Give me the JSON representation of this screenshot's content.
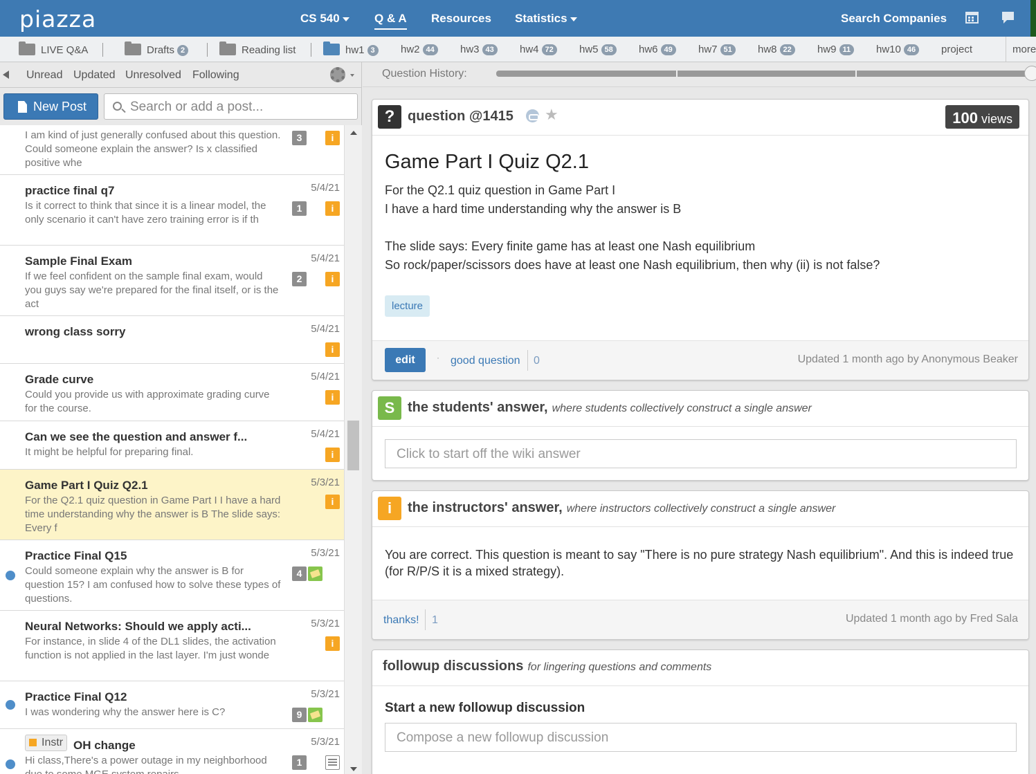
{
  "nav": {
    "logo": "piazza",
    "course": "CS 540",
    "qa": "Q & A",
    "resources": "Resources",
    "statistics": "Statistics",
    "search_companies": "Search Companies"
  },
  "folders": [
    {
      "label": "LIVE Q&A",
      "count": ""
    },
    {
      "label": "Drafts",
      "count": "2"
    },
    {
      "label": "Reading list",
      "count": ""
    },
    {
      "label": "hw1",
      "count": "3"
    },
    {
      "label": "hw2",
      "count": "44"
    },
    {
      "label": "hw3",
      "count": "43"
    },
    {
      "label": "hw4",
      "count": "72"
    },
    {
      "label": "hw5",
      "count": "58"
    },
    {
      "label": "hw6",
      "count": "49"
    },
    {
      "label": "hw7",
      "count": "51"
    },
    {
      "label": "hw8",
      "count": "22"
    },
    {
      "label": "hw9",
      "count": "11"
    },
    {
      "label": "hw10",
      "count": "46"
    },
    {
      "label": "project",
      "count": ""
    },
    {
      "label": "more",
      "count": ""
    }
  ],
  "filters": {
    "unread": "Unread",
    "updated": "Updated",
    "unresolved": "Unresolved",
    "following": "Following"
  },
  "newpost": "New Post",
  "search_placeholder": "Search or add a post...",
  "posts": [
    {
      "title": "",
      "body": "I am kind of just generally confused about this question. Could someone explain the answer? Is x classified positive whe",
      "date": "",
      "count": "3"
    },
    {
      "title": "practice final q7",
      "body": "Is it correct to think that since it is a linear model, the only scenario it can't have zero training error is if th",
      "date": "5/4/21",
      "count": "1"
    },
    {
      "title": "Sample Final Exam",
      "body": "If we feel confident on the sample final exam, would you guys say we're prepared for the final itself, or is the act",
      "date": "5/4/21",
      "count": "2"
    },
    {
      "title": "wrong class sorry",
      "body": "",
      "date": "5/4/21",
      "count": ""
    },
    {
      "title": "Grade curve",
      "body": "Could you provide us with approximate grading curve for the course.",
      "date": "5/4/21",
      "count": ""
    },
    {
      "title": "Can we see the question and answer f...",
      "body": "It might be helpful for preparing final.",
      "date": "5/4/21",
      "count": ""
    },
    {
      "title": "Game Part I Quiz Q2.1",
      "body": "For the Q2.1 quiz question in Game Part I  I have a hard time understanding why the answer is B The slide says: Every f",
      "date": "5/3/21",
      "count": ""
    },
    {
      "title": "Practice Final Q15",
      "body": "Could someone explain why the answer is B for question 15? I am confused how to solve these types of questions.",
      "date": "5/3/21",
      "count": "4"
    },
    {
      "title": "Neural Networks: Should we apply acti...",
      "body": "For instance, in slide 4 of the DL1 slides, the activation function is not applied in the last layer. I'm just wonde",
      "date": "5/3/21",
      "count": ""
    },
    {
      "title": "Practice Final Q12",
      "body": "I was wondering why the answer here is C?",
      "date": "5/3/21",
      "count": "9"
    },
    {
      "title": "OH change",
      "body": "Hi class,There's a power outage in my neighborhood due to some MGE system repairs",
      "date": "5/3/21",
      "count": "1",
      "instr": "Instr"
    }
  ],
  "badge_i": "i",
  "history_label": "Question History:",
  "question": {
    "icon": "?",
    "header": "question @1415",
    "views_num": "100",
    "views_label": "views",
    "title": "Game Part I Quiz Q2.1",
    "lines": [
      "For the Q2.1 quiz question in Game Part I",
      "I have a hard time understanding why the answer is B",
      "",
      "The slide says: Every finite game has at least one Nash equilibrium",
      "So rock/paper/scissors does have at least one Nash equilibrium, then why (ii) is not false?"
    ],
    "tag": "lecture",
    "edit": "edit",
    "dot": "·",
    "good": "good question",
    "good_count": "0",
    "updated": "Updated 1 month ago by Anonymous Beaker"
  },
  "students": {
    "icon": "S",
    "title": "the students' answer,",
    "sub": "where students collectively construct a single answer",
    "placeholder": "Click to start off the wiki answer"
  },
  "instructors": {
    "icon": "i",
    "title": "the instructors' answer,",
    "sub": "where instructors collectively construct a single answer",
    "body": "You are correct. This question is meant to say \"There is no pure strategy Nash equilibrium\". And this is indeed true (for R/P/S it is a mixed strategy).",
    "thanks": "thanks!",
    "thanks_count": "1",
    "updated": "Updated 1 month ago by Fred Sala"
  },
  "followup": {
    "title": "followup discussions",
    "sub": "for lingering questions and comments",
    "start": "Start a new followup discussion",
    "placeholder": "Compose a new followup discussion"
  }
}
